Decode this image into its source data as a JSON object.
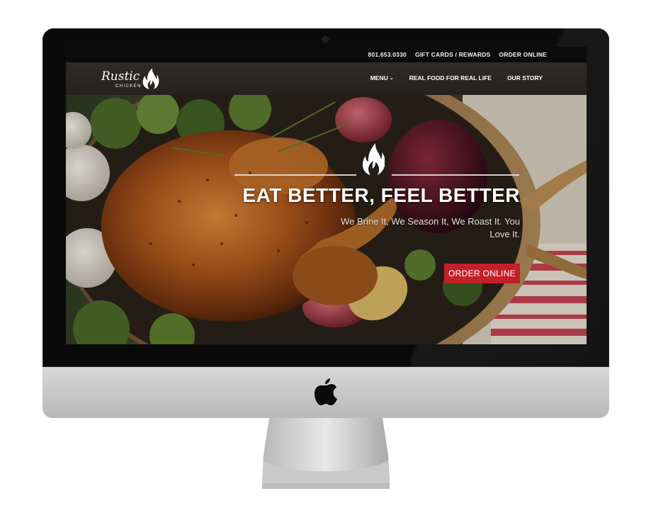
{
  "site": {
    "logo_text_top": "Rustic",
    "logo_text_bottom": "CHICKEN"
  },
  "utility_nav": {
    "phone": "801.653.0330",
    "gift_cards": "GIFT CARDS / REWARDS",
    "order_online": "ORDER ONLINE"
  },
  "main_nav": {
    "menu": "MENU",
    "real_food": "REAL FOOD FOR REAL LIFE",
    "our_story": "OUR STORY"
  },
  "hero": {
    "title": "EAT BETTER, FEEL BETTER",
    "subtitle": "We Brine It, We Season It, We Roast It. You Love It.",
    "cta": "ORDER ONLINE"
  },
  "colors": {
    "cta_red": "#c4202a",
    "nav_bg": "#2a2624",
    "topbar_bg": "#0b0b0b"
  },
  "icons": [
    "flame-icon",
    "apple-icon",
    "chevron-down-icon",
    "camera-icon"
  ]
}
